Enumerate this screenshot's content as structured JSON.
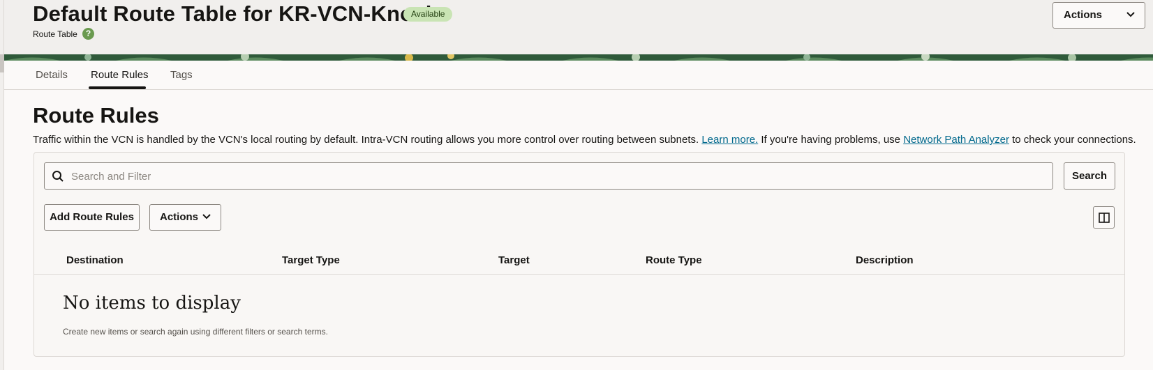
{
  "header": {
    "title": "Default Route Table for KR-VCN-Knock",
    "status": "Available",
    "subtitle": "Route Table",
    "help_icon": "?",
    "actions_label": "Actions"
  },
  "tabs": [
    {
      "label": "Details"
    },
    {
      "label": "Route Rules"
    },
    {
      "label": "Tags"
    }
  ],
  "section": {
    "title": "Route Rules",
    "intro_text": "Traffic within the VCN is handled by the VCN's local routing by default. Intra-VCN routing allows you more control over routing between subnets.",
    "learn_more_link": "Learn more.",
    "intro_text_2": "If you're having problems, use",
    "analyzer_link": "Network Path Analyzer",
    "intro_text_3": "to check your connections."
  },
  "search": {
    "placeholder": "Search and Filter",
    "button_label": "Search"
  },
  "toolbar": {
    "add_label": "Add Route Rules",
    "actions_label": "Actions"
  },
  "table": {
    "columns": [
      "Destination",
      "Target Type",
      "Target",
      "Route Type",
      "Description"
    ],
    "empty_title": "No items to display",
    "empty_subtitle": "Create new items or search again using different filters or search terms."
  },
  "colors": {
    "accent_link": "#00688c",
    "badge_bg": "#c9e4b4",
    "banner_green": "#2f5a3a"
  }
}
